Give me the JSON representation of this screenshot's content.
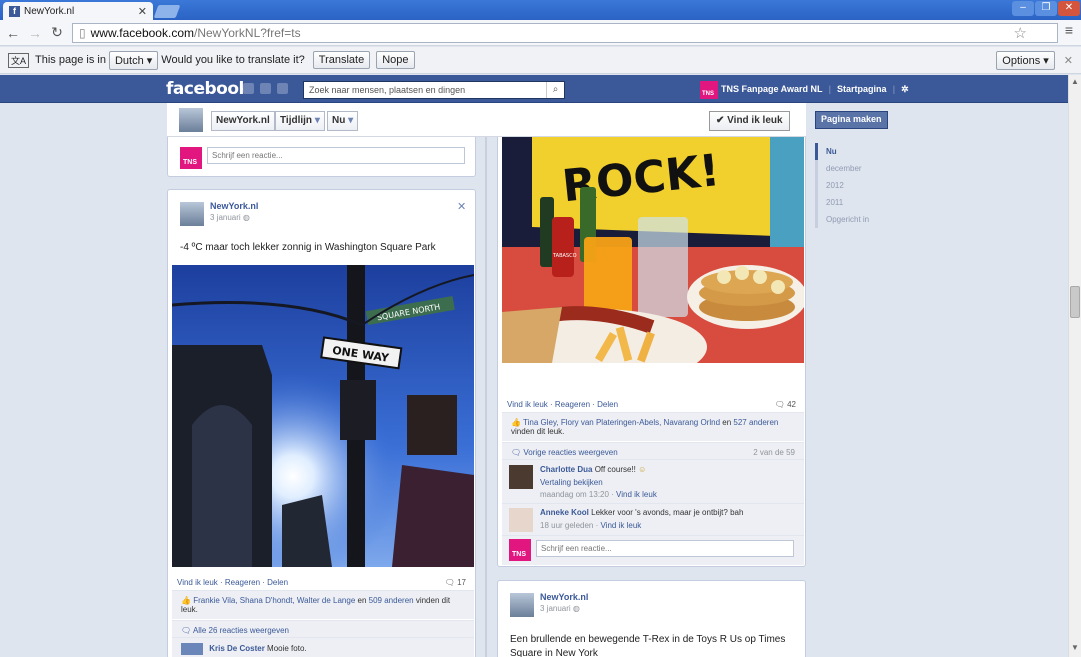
{
  "browser": {
    "tab_title": "NewYork.nl",
    "tab_favicon": "f",
    "url_domain": "www.facebook.com",
    "url_path": "/NewYorkNL?fref=ts",
    "translate": {
      "prefix": "This page is in",
      "language": "Dutch",
      "question": "Would you like to translate it?",
      "translate_label": "Translate",
      "nope_label": "Nope",
      "options_label": "Options"
    }
  },
  "facebook": {
    "logo": "facebook",
    "search_placeholder": "Zoek naar mensen, plaatsen en dingen",
    "tns_logo": "TNS",
    "topnav": [
      "TNS Fanpage Award NL",
      "Startpagina"
    ],
    "page_name": "NewYork.nl",
    "timeline_label": "Tijdlijn",
    "now_label": "Nu",
    "like_label": "Vind ik leuk",
    "make_page_label": "Pagina maken"
  },
  "timeline_nav": [
    "Nu",
    "december",
    "2012",
    "2011",
    "Opgericht in"
  ],
  "left_top_card": {
    "comment_placeholder": "Schrijf een reactie..."
  },
  "left_post": {
    "author": "NewYork.nl",
    "date": "3 januari",
    "text": "-4 ºC maar toch lekker zonnig in Washington Square Park",
    "sign_text": "ONE WAY",
    "street_sign": "SQUARE NORTH",
    "actions": [
      "Vind ik leuk",
      "Reageren",
      "Delen"
    ],
    "comment_count": "17",
    "likes_names": "Frankie Vila, Shana D'hondt, Walter de Lange",
    "likes_en": "en",
    "likes_others": "509 anderen",
    "likes_suffix": "vinden dit leuk.",
    "all_comments": "Alle 26 reacties weergeven",
    "comment": {
      "author": "Kris De Coster",
      "text": "Mooie foto."
    }
  },
  "right_post": {
    "photo_caption_letters": "ROCK!",
    "bottle_label": "TABASCO",
    "actions": [
      "Vind ik leuk",
      "Reageren",
      "Delen"
    ],
    "comment_count": "42",
    "likes_names": "Tina Gley, Flory van Plateringen-Abels, Navarang Orlnd",
    "likes_en": "en",
    "likes_others": "527 anderen",
    "likes_suffix": "vinden dit leuk.",
    "prev_comments": "Vorige reacties weergeven",
    "pagination": "2 van de 59",
    "comments": [
      {
        "author": "Charlotte Dua",
        "text": "Off course!!",
        "extra": "Vertaling bekijken",
        "meta": "maandag om 13:20",
        "like": "Vind ik leuk"
      },
      {
        "author": "Anneke Kool",
        "text": "Lekker voor 's avonds, maar je ontbijt? bah",
        "meta": "18 uur geleden",
        "like": "Vind ik leuk"
      }
    ],
    "comment_placeholder": "Schrijf een reactie..."
  },
  "right_post2": {
    "author": "NewYork.nl",
    "date": "3 januari",
    "text": "Een brullende en bewegende T-Rex in de Toys R Us op Times Square in New York"
  },
  "colors": {
    "facebook_blue": "#3b5998",
    "tns_pink": "#e2167f",
    "chrome_blue": "#2a63c3"
  }
}
